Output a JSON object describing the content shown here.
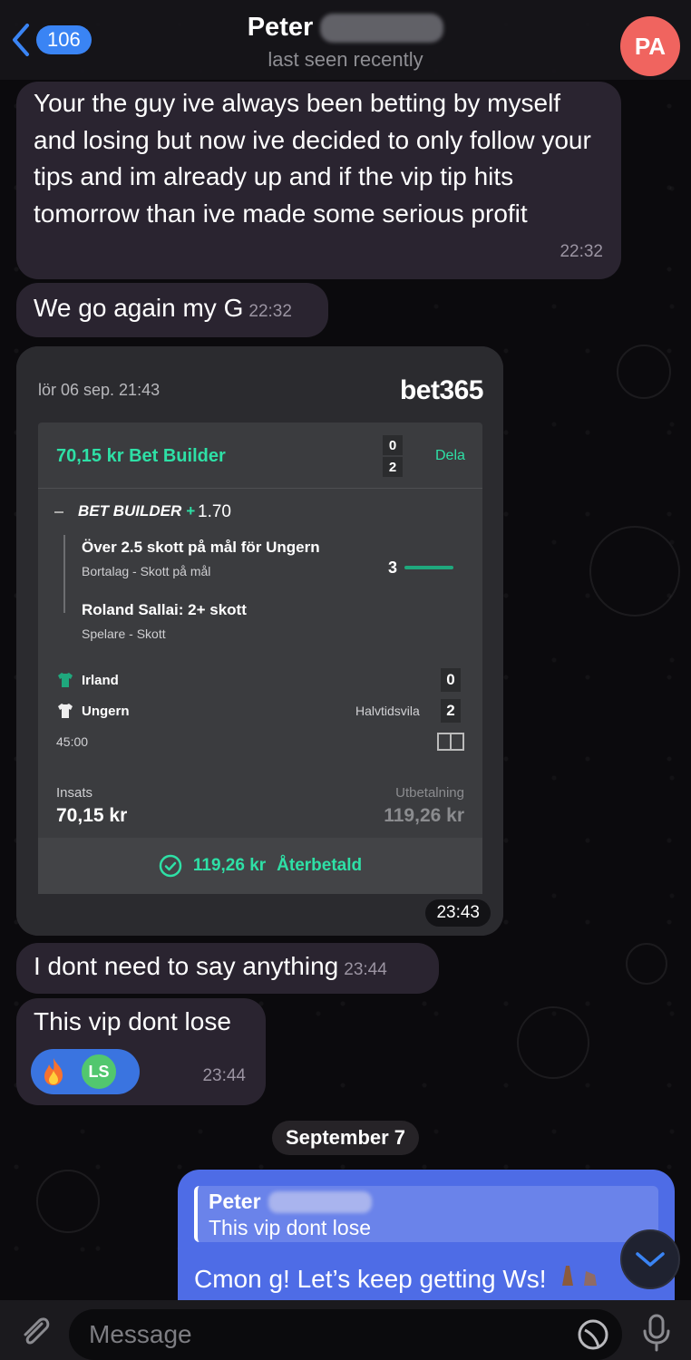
{
  "header": {
    "back_count": "106",
    "name": "Peter",
    "status": "last seen recently",
    "avatar_initials": "PA"
  },
  "messages": [
    {
      "text": "Your the guy ive always been betting by myself and losing but now ive decided to only follow your tips and im already up and if the vip tip hits tomorrow than ive made some serious profit",
      "time": "22:32"
    },
    {
      "text": "We go again my G",
      "time": "22:32"
    },
    {
      "text": "I dont need to say anything",
      "time": "23:44"
    },
    {
      "text": "This vip dont lose",
      "time": "23:44",
      "reaction_user": "LS"
    }
  ],
  "bet_screenshot": {
    "date": "lör 06 sep. 21:43",
    "logo": "bet365",
    "title": "70,15 kr Bet Builder",
    "score_top": "0",
    "score_bottom": "2",
    "share": "Dela",
    "builder_label": "BET BUILDER",
    "builder_plus": "+",
    "odds": "1.70",
    "leg1_title": "Över 2.5 skott på mål för Ungern",
    "leg1_sub": "Bortalag - Skott på mål",
    "leg1_progress": "3",
    "leg2_title": "Roland Sallai: 2+ skott",
    "leg2_sub": "Spelare - Skott",
    "team1": "Irland",
    "team1_score": "0",
    "team2": "Ungern",
    "team2_score": "2",
    "half": "Halvtidsvila",
    "clock": "45:00",
    "stake_label": "Insats",
    "stake_value": "70,15 kr",
    "payout_label": "Utbetalning",
    "payout_value": "119,26 kr",
    "returned_amount": "119,26  kr",
    "returned_label": "Återbetald",
    "time": "23:43"
  },
  "date_separator": "September 7",
  "outgoing": {
    "reply_name": "Peter",
    "reply_text": "This vip dont lose",
    "text": "Cmon g! Let’s keep getting Ws!"
  },
  "input": {
    "placeholder": "Message"
  },
  "colors": {
    "accent": "#3a84f4",
    "bet365_green": "#2ee0a6",
    "outgoing": "#4e6ce6",
    "incoming": "#2a2430"
  }
}
